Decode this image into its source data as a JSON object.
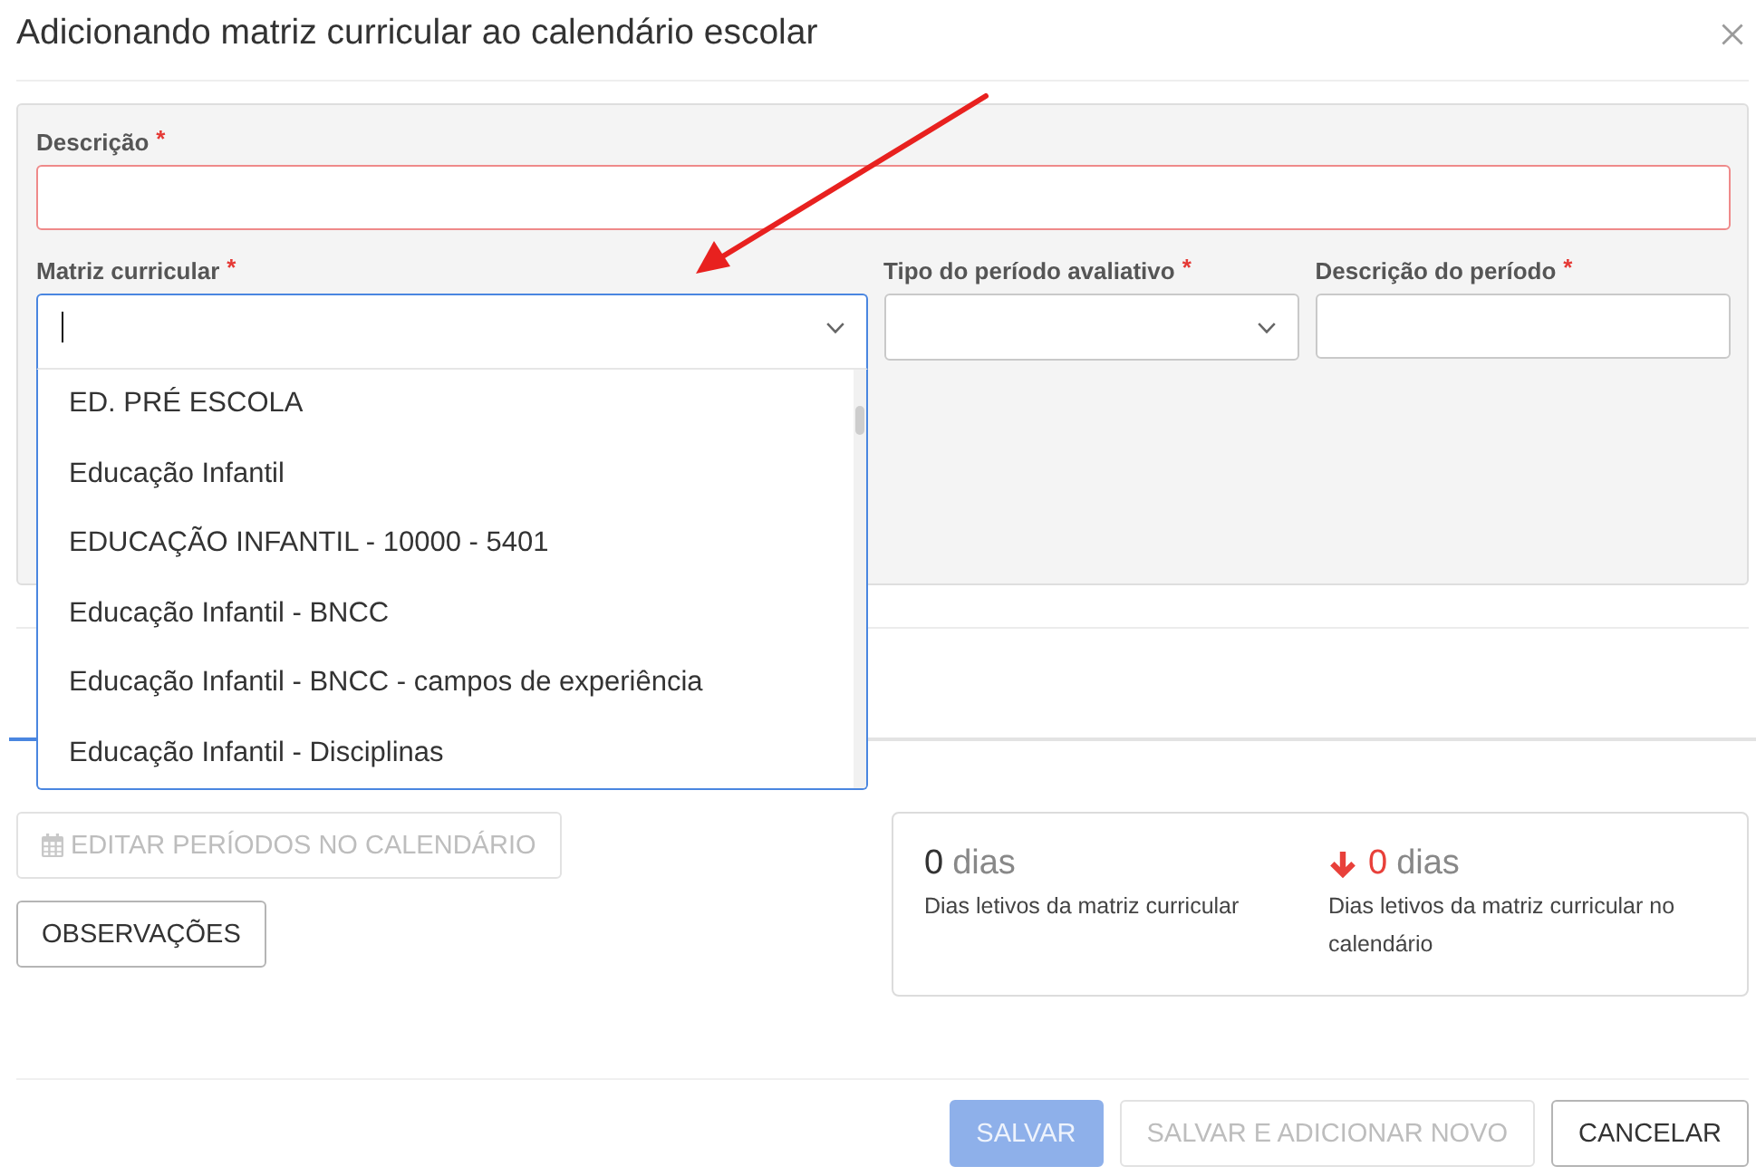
{
  "dialog": {
    "title": "Adicionando matriz curricular ao calendário escolar"
  },
  "form": {
    "rows": [
      {
        "fields": [
          {
            "kind": "input",
            "label": "Descrição",
            "required_mark": "*",
            "invalid": true,
            "focused": false
          }
        ]
      },
      {
        "fields": [
          {
            "kind": "select",
            "label": "Matriz curricular",
            "required_mark": "*",
            "invalid": false,
            "focused": true,
            "expanded": true,
            "options": [
              {
                "label": "ED. PRÉ ESCOLA",
                "selected": false
              },
              {
                "label": "Educação Infantil",
                "selected": false
              },
              {
                "label": "EDUCAÇÃO INFANTIL - 10000 - 5401",
                "selected": false
              },
              {
                "label": "Educação Infantil - BNCC",
                "selected": false
              },
              {
                "label": "Educação Infantil - BNCC - campos de experiência",
                "selected": false
              },
              {
                "label": "Educação Infantil - Disciplinas",
                "selected": false
              }
            ]
          },
          {
            "kind": "select",
            "label": "Tipo do período avaliativo",
            "required_mark": "*",
            "invalid": false,
            "focused": false,
            "expanded": false
          },
          {
            "kind": "input",
            "label": "Descrição do período",
            "required_mark": "*",
            "invalid": false,
            "focused": false
          }
        ]
      }
    ]
  },
  "actions": {
    "buttons": [
      {
        "label": "EDITAR PERÍODOS NO CALENDÁRIO",
        "kind": "icon",
        "disabled": true
      },
      {
        "label": "OBSERVAÇÕES",
        "kind": "text",
        "disabled": false
      }
    ]
  },
  "summary": {
    "stats": [
      {
        "value": "0",
        "unit": "dias",
        "caption": "Dias letivos da matriz curricular",
        "decreased": false
      },
      {
        "value": "0",
        "unit": "dias",
        "caption": "Dias letivos da matriz curricular no calendário",
        "decreased": true
      }
    ]
  },
  "footer": {
    "buttons": [
      {
        "label": "SALVAR",
        "kind": "primary",
        "disabled": true
      },
      {
        "label": "SALVAR E ADICIONAR NOVO",
        "kind": "default",
        "disabled": true
      },
      {
        "label": "CANCELAR",
        "kind": "default",
        "disabled": false
      }
    ]
  }
}
